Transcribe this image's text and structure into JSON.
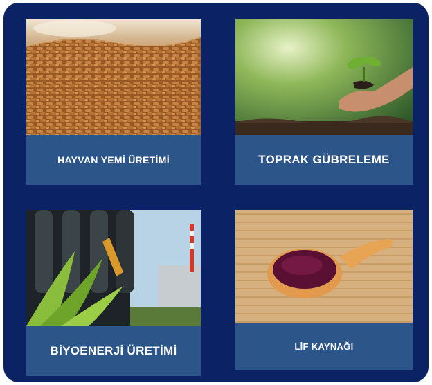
{
  "cards": [
    {
      "label": "HAYVAN YEMİ ÜRETİMİ",
      "image": "animal-feed-pellets"
    },
    {
      "label": "TOPRAK GÜBRELEME",
      "image": "hands-holding-seedling-in-soil"
    },
    {
      "label": "BİYOENERJİ ÜRETİMİ",
      "image": "fuel-nozzles-with-grass-and-factory"
    },
    {
      "label": "LİF KAYNAĞI",
      "image": "wooden-spoon-with-purple-powder"
    }
  ],
  "colors": {
    "panel": "#0b2264",
    "label_bg": "#2c5589",
    "label_text": "#ffffff"
  }
}
